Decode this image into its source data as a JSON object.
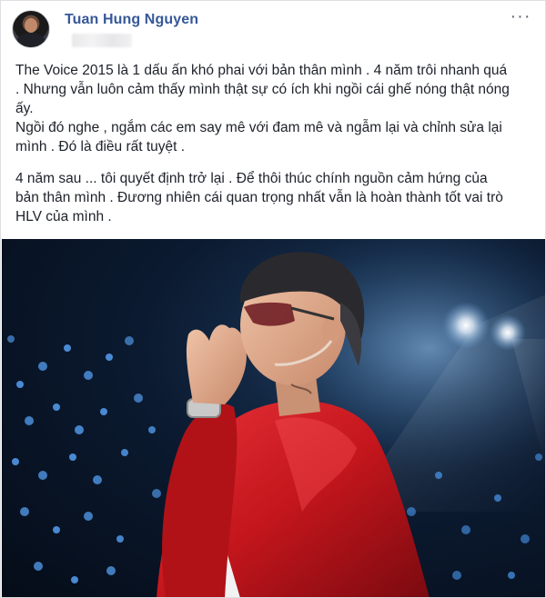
{
  "post": {
    "author": "Tuan Hung Nguyen",
    "more_icon": "more-horizontal-icon",
    "more_glyph": "···",
    "paragraphs": [
      "The Voice 2015 là 1 dấu ấn khó phai với bản thân mình . 4 năm trôi nhanh quá\n. Nhưng vẫn luôn cảm thấy mình thật sự có ích khi ngồi cái ghế nóng thật nóng\nấy.\nNgồi đó nghe , ngắm các em say mê với đam mê và ngẫm lại và chỉnh sửa lại\nmình . Đó là điều rất tuyệt .",
      "4 năm sau ... tôi quyết định trở lại . Để thôi thúc chính nguồn cảm hứng của\nbản thân mình . Đương nhiên cái quan trọng nhất vẫn là hoàn thành tốt vai trò\nHLV của mình ."
    ]
  },
  "colors": {
    "author_link": "#365899",
    "text": "#1d2129",
    "jacket": "#c4161c"
  }
}
